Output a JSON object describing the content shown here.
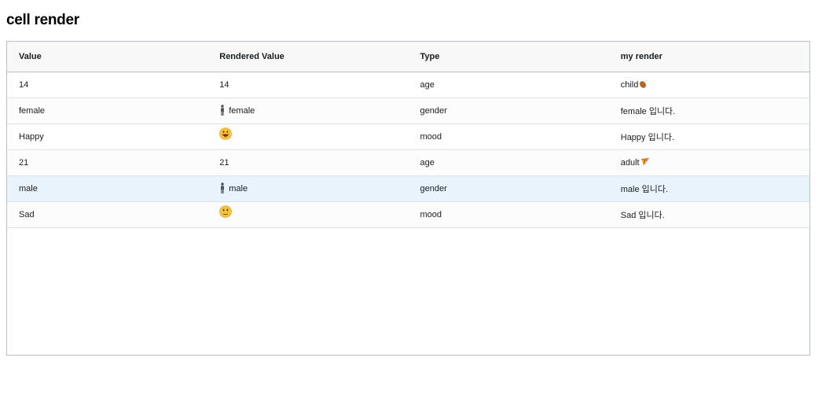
{
  "page": {
    "title": "cell render"
  },
  "columns": [
    "Value",
    "Rendered Value",
    "Type",
    "my render"
  ],
  "rows": [
    {
      "value": "14",
      "rendered_text": "14",
      "rendered_icon": "",
      "type": "age",
      "my_render_text": "child",
      "my_render_icon": "drumstick-icon"
    },
    {
      "value": "female",
      "rendered_text": "female",
      "rendered_icon": "person-icon",
      "type": "gender",
      "my_render_text": "female 입니다.",
      "my_render_icon": ""
    },
    {
      "value": "Happy",
      "rendered_text": "",
      "rendered_icon": "happy-face-icon",
      "type": "mood",
      "my_render_text": "Happy 입니다.",
      "my_render_icon": ""
    },
    {
      "value": "21",
      "rendered_text": "21",
      "rendered_icon": "",
      "type": "age",
      "my_render_text": "adult",
      "my_render_icon": "pizza-icon"
    },
    {
      "value": "male",
      "rendered_text": "male",
      "rendered_icon": "person-icon",
      "type": "gender",
      "my_render_text": "male 입니다.",
      "my_render_icon": ""
    },
    {
      "value": "Sad",
      "rendered_text": "",
      "rendered_icon": "neutral-face-icon",
      "type": "mood",
      "my_render_text": "Sad 입니다.",
      "my_render_icon": ""
    }
  ],
  "selected_row_index": 4,
  "colors": {
    "border": "#babfc7",
    "header_bg": "#f8f8f8",
    "selected_row_bg": "#e8f3fc",
    "row_divider": "#dde2eb"
  }
}
